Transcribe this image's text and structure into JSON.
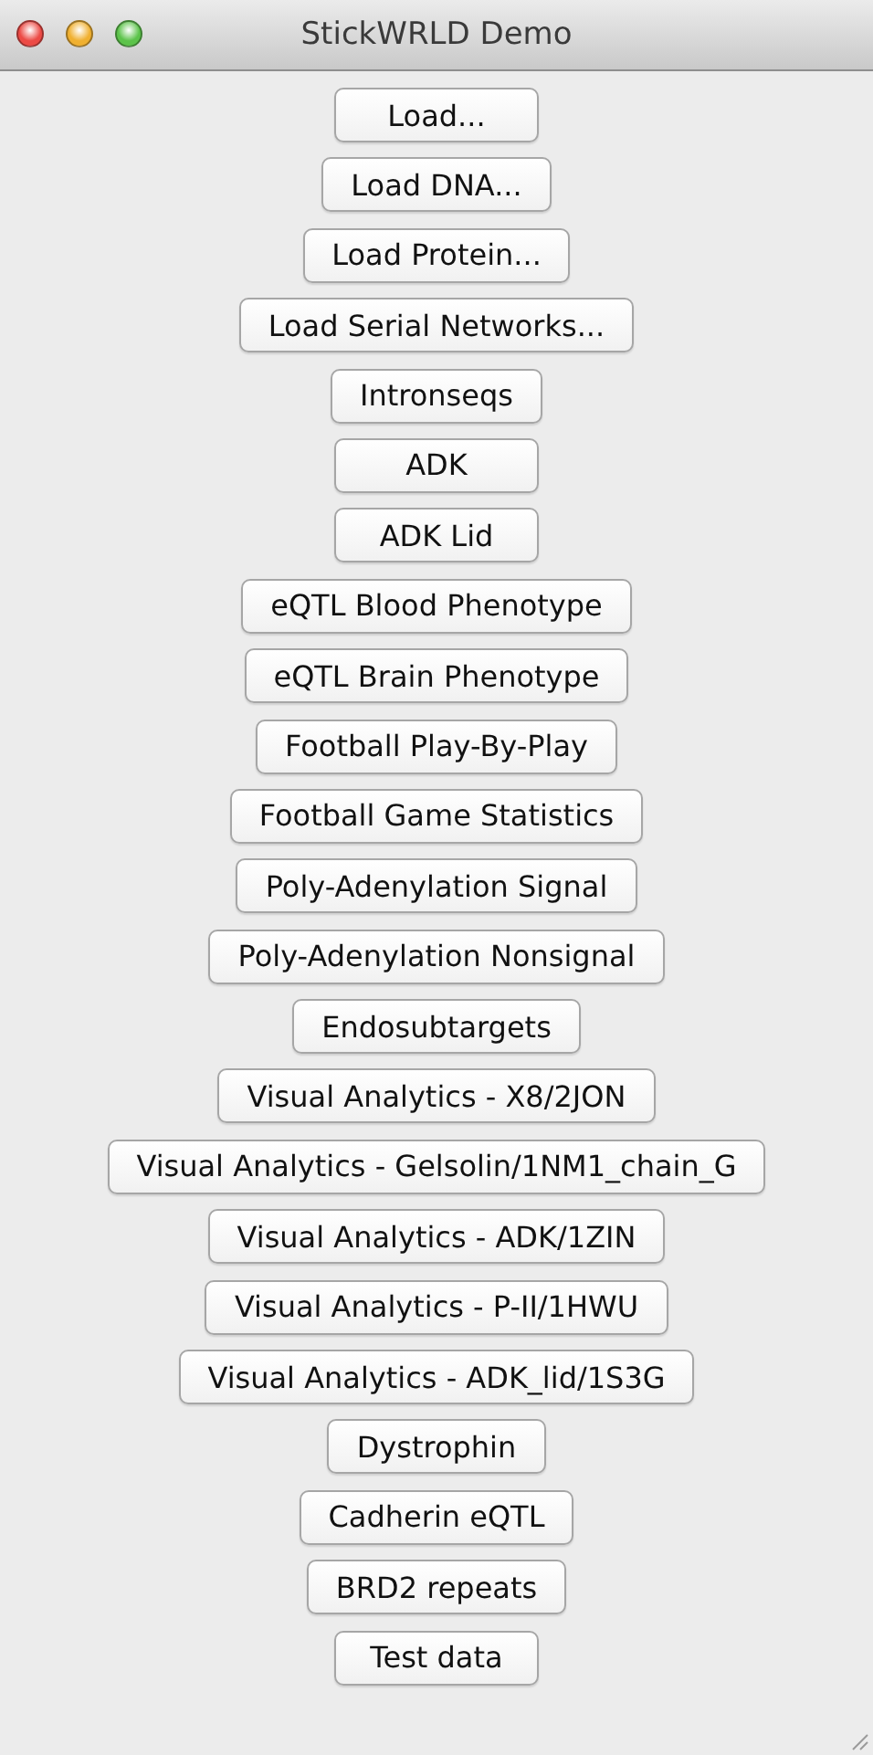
{
  "window": {
    "title": "StickWRLD Demo"
  },
  "buttons": [
    "Load...",
    "Load DNA...",
    "Load Protein...",
    "Load Serial Networks...",
    "Intronseqs",
    "ADK",
    "ADK Lid",
    "eQTL Blood Phenotype",
    "eQTL Brain Phenotype",
    "Football Play-By-Play",
    "Football Game Statistics",
    "Poly-Adenylation Signal",
    "Poly-Adenylation Nonsignal",
    "Endosubtargets",
    "Visual Analytics - X8/2JON",
    "Visual Analytics - Gelsolin/1NM1_chain_G",
    "Visual Analytics - ADK/1ZIN",
    "Visual Analytics - P-II/1HWU",
    "Visual Analytics - ADK_lid/1S3G",
    "Dystrophin",
    "Cadherin eQTL",
    "BRD2 repeats",
    "Test data"
  ]
}
